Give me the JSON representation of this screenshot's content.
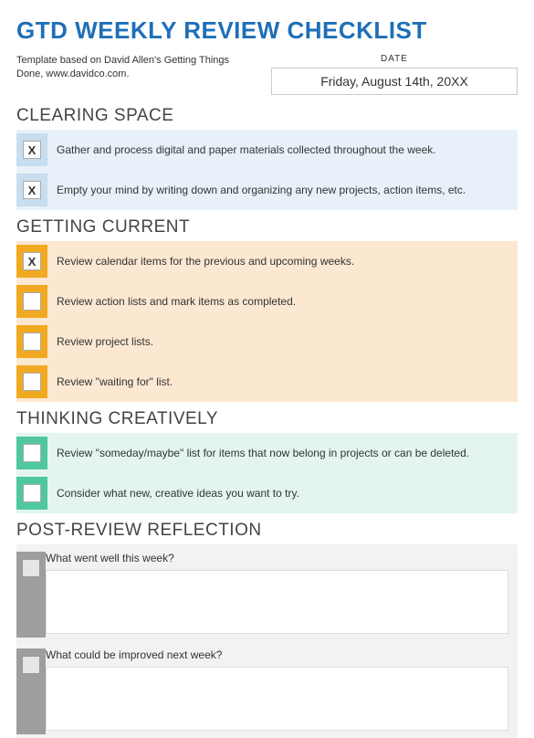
{
  "title": "GTD WEEKLY REVIEW CHECKLIST",
  "subtitle": "Template based on David Allen's Getting Things Done, www.davidco.com.",
  "date": {
    "label": "DATE",
    "value": "Friday, August 14th, 20XX"
  },
  "sections": {
    "clearing": {
      "heading": "CLEARING SPACE",
      "items": [
        {
          "mark": "X",
          "text": "Gather and process digital and paper materials collected throughout the week."
        },
        {
          "mark": "X",
          "text": "Empty your mind by writing down and organizing any new projects, action items, etc."
        }
      ]
    },
    "current": {
      "heading": "GETTING CURRENT",
      "items": [
        {
          "mark": "X",
          "text": "Review calendar items for the previous and upcoming weeks."
        },
        {
          "mark": "",
          "text": "Review action lists and mark items as completed."
        },
        {
          "mark": "",
          "text": "Review project lists."
        },
        {
          "mark": "",
          "text": "Review \"waiting for\" list."
        }
      ]
    },
    "creative": {
      "heading": "THINKING CREATIVELY",
      "items": [
        {
          "mark": "",
          "text": "Review \"someday/maybe\" list for items that now belong in projects or can be deleted."
        },
        {
          "mark": "",
          "text": "Consider what new, creative ideas you want to try."
        }
      ]
    },
    "reflection": {
      "heading": "POST-REVIEW REFLECTION",
      "items": [
        {
          "prompt": "What went well this week?"
        },
        {
          "prompt": "What could be improved next week?"
        }
      ]
    }
  }
}
